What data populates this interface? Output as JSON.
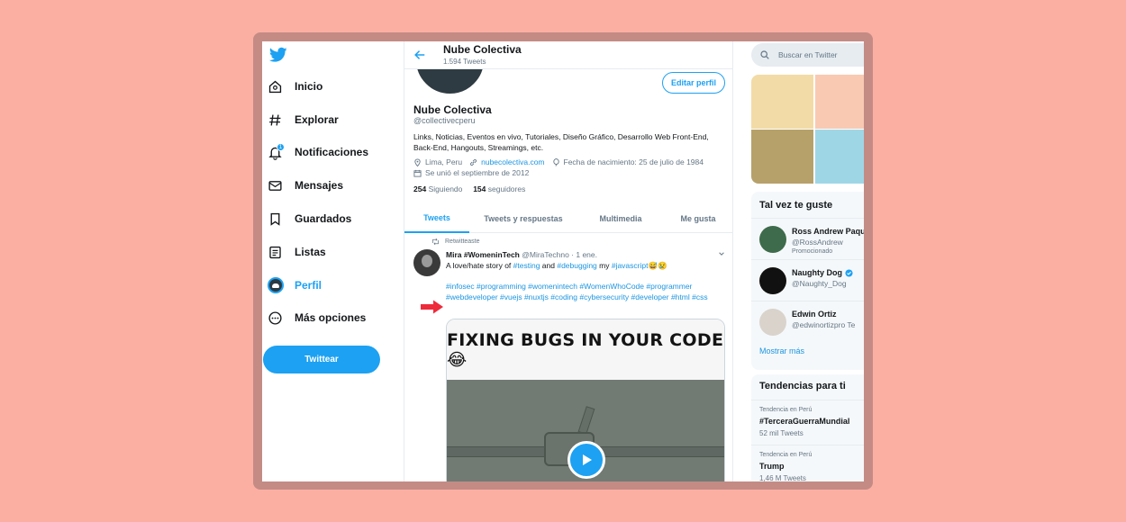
{
  "nav": {
    "items": [
      {
        "label": "Inicio",
        "icon": "home-icon"
      },
      {
        "label": "Explorar",
        "icon": "hashtag-icon"
      },
      {
        "label": "Notificaciones",
        "icon": "bell-icon",
        "badge": "1"
      },
      {
        "label": "Mensajes",
        "icon": "envelope-icon"
      },
      {
        "label": "Guardados",
        "icon": "bookmark-icon"
      },
      {
        "label": "Listas",
        "icon": "list-icon"
      },
      {
        "label": "Perfil",
        "icon": "profile-avatar-icon",
        "active": true
      },
      {
        "label": "Más opciones",
        "icon": "more-icon"
      }
    ],
    "tweet_button": "Twittear"
  },
  "header": {
    "title": "Nube Colectiva",
    "tweet_count": "1.594 Tweets"
  },
  "profile": {
    "edit_button": "Editar perfil",
    "name": "Nube Colectiva",
    "handle": "@collectivecperu",
    "bio": "Links, Noticias, Eventos en vivo, Tutoriales, Diseño Gráfico, Desarrollo Web Front-End, Back-End, Hangouts, Streamings, etc.",
    "location": "Lima, Peru",
    "website": "nubecolectiva.com",
    "birthday": "Fecha de nacimiento: 25 de julio de 1984",
    "joined": "Se unió el septiembre de 2012",
    "following_count": "254",
    "following_label": "Siguiendo",
    "followers_count": "154",
    "followers_label": "seguidores"
  },
  "tabs": [
    "Tweets",
    "Tweets y respuestas",
    "Multimedia",
    "Me gusta"
  ],
  "tweet": {
    "retweet_label": "Retwitteaste",
    "author": "Mira #WomeninTech",
    "handle_time": "@MiraTechno · 1 ene.",
    "text_start": "A love/hate story of ",
    "tag_testing": "#testing",
    "text_and": " and ",
    "tag_debugging": "#debugging",
    "text_my": " my ",
    "tag_javascript": "#javascript",
    "emojis": "😅😢",
    "hashtags": "#infosec #programming #womenintech #WomenWhoCode #programmer #webdeveloper #vuejs #nuxtjs #coding #cybersecurity #developer #html #css",
    "media_caption": "FIXING BUGS IN YOUR CODE 😂"
  },
  "sidebar": {
    "search_placeholder": "Buscar en Twitter",
    "suggestions_title": "Tal vez te guste",
    "suggestions": [
      {
        "name": "Ross Andrew Paque",
        "handle": "@RossAndrew",
        "promo": "Promocionado"
      },
      {
        "name": "Naughty Dog",
        "handle": "@Naughty_Dog",
        "verified": true
      },
      {
        "name": "Edwin Ortiz",
        "handle": "@edwinortizpro",
        "extra": "Te"
      }
    ],
    "show_more": "Mostrar más",
    "trends_title": "Tendencias para ti",
    "trends": [
      {
        "context": "Tendencia en Perú",
        "topic": "#TerceraGuerraMundial",
        "count": "52 mil Tweets"
      },
      {
        "context": "Tendencia en Perú",
        "topic": "Trump",
        "count": "1,46 M Tweets"
      }
    ]
  },
  "colors": {
    "accent": "#1da1f2",
    "link": "#1b95e0",
    "background": "#fbafa2",
    "frame": "#c48b85",
    "arrow": "#ee2b3b"
  }
}
